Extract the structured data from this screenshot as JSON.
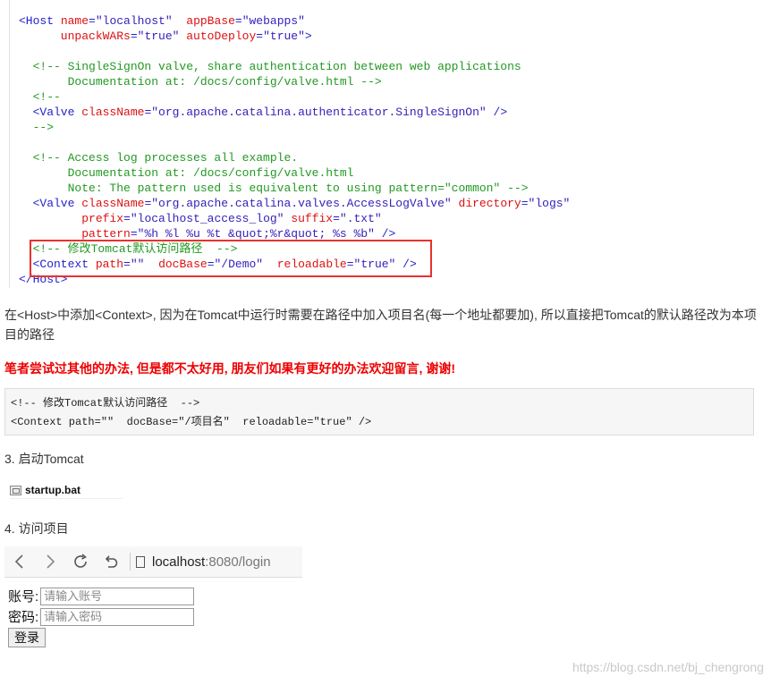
{
  "code_lines": [
    {
      "parts": [
        {
          "c": "tag",
          "t": "<Host "
        },
        {
          "c": "attr",
          "t": "name"
        },
        {
          "c": "tag",
          "t": "="
        },
        {
          "c": "val",
          "t": "\"localhost\""
        },
        {
          "c": "attr",
          "t": "  appBase"
        },
        {
          "c": "tag",
          "t": "="
        },
        {
          "c": "val",
          "t": "\"webapps\""
        }
      ]
    },
    {
      "parts": [
        {
          "c": "attr",
          "t": "      unpackWARs"
        },
        {
          "c": "tag",
          "t": "="
        },
        {
          "c": "val",
          "t": "\"true\""
        },
        {
          "c": "attr",
          "t": " autoDeploy"
        },
        {
          "c": "tag",
          "t": "="
        },
        {
          "c": "val",
          "t": "\"true\""
        },
        {
          "c": "tag",
          "t": ">"
        }
      ]
    },
    {
      "parts": [
        {
          "c": "cmt",
          "t": ""
        }
      ]
    },
    {
      "parts": [
        {
          "c": "cmt",
          "t": "  <!-- SingleSignOn valve, share authentication between web applications"
        }
      ]
    },
    {
      "parts": [
        {
          "c": "cmt",
          "t": "       Documentation at: /docs/config/valve.html -->"
        }
      ]
    },
    {
      "parts": [
        {
          "c": "cmt",
          "t": "  <!--"
        }
      ]
    },
    {
      "parts": [
        {
          "c": "tag",
          "t": "  <Valve "
        },
        {
          "c": "attr",
          "t": "className"
        },
        {
          "c": "tag",
          "t": "="
        },
        {
          "c": "val",
          "t": "\"org.apache.catalina.authenticator.SingleSignOn\""
        },
        {
          "c": "tag",
          "t": " />"
        }
      ]
    },
    {
      "parts": [
        {
          "c": "cmt",
          "t": "  -->"
        }
      ]
    },
    {
      "parts": [
        {
          "c": "cmt",
          "t": ""
        }
      ]
    },
    {
      "parts": [
        {
          "c": "cmt",
          "t": "  <!-- Access log processes all example."
        }
      ]
    },
    {
      "parts": [
        {
          "c": "cmt",
          "t": "       Documentation at: /docs/config/valve.html"
        }
      ]
    },
    {
      "parts": [
        {
          "c": "cmt",
          "t": "       Note: The pattern used is equivalent to using pattern=\"common\" -->"
        }
      ]
    },
    {
      "parts": [
        {
          "c": "tag",
          "t": "  <Valve "
        },
        {
          "c": "attr",
          "t": "className"
        },
        {
          "c": "tag",
          "t": "="
        },
        {
          "c": "val",
          "t": "\"org.apache.catalina.valves.AccessLogValve\""
        },
        {
          "c": "attr",
          "t": " directory"
        },
        {
          "c": "tag",
          "t": "="
        },
        {
          "c": "val",
          "t": "\"logs\""
        }
      ]
    },
    {
      "parts": [
        {
          "c": "attr",
          "t": "         prefix"
        },
        {
          "c": "tag",
          "t": "="
        },
        {
          "c": "val",
          "t": "\"localhost_access_log\""
        },
        {
          "c": "attr",
          "t": " suffix"
        },
        {
          "c": "tag",
          "t": "="
        },
        {
          "c": "val",
          "t": "\".txt\""
        }
      ]
    },
    {
      "parts": [
        {
          "c": "attr",
          "t": "         pattern"
        },
        {
          "c": "tag",
          "t": "="
        },
        {
          "c": "val",
          "t": "\"%h %l %u %t &quot;%r&quot; %s %b\""
        },
        {
          "c": "tag",
          "t": " />"
        }
      ]
    },
    {
      "parts": [
        {
          "c": "cmt",
          "t": "  <!-- 修改Tomcat默认访问路径  -->"
        }
      ]
    },
    {
      "parts": [
        {
          "c": "tag",
          "t": "  <Context "
        },
        {
          "c": "attr",
          "t": "path"
        },
        {
          "c": "tag",
          "t": "="
        },
        {
          "c": "val",
          "t": "\"\""
        },
        {
          "c": "attr",
          "t": "  docBase"
        },
        {
          "c": "tag",
          "t": "="
        },
        {
          "c": "val",
          "t": "\"/Demo\""
        },
        {
          "c": "attr",
          "t": "  reloadable"
        },
        {
          "c": "tag",
          "t": "="
        },
        {
          "c": "val",
          "t": "\"true\""
        },
        {
          "c": "tag",
          "t": " />"
        }
      ]
    },
    {
      "parts": [
        {
          "c": "tag",
          "t": "</Host>"
        }
      ]
    }
  ],
  "paragraph": "在<Host>中添加<Context>, 因为在Tomcat中运行时需要在路径中加入项目名(每一个地址都要加), 所以直接把Tomcat的默认路径改为本项目的路径",
  "note": "笔者尝试过其他的办法, 但是都不太好用, 朋友们如果有更好的办法欢迎留言, 谢谢!",
  "snippet": "<!-- 修改Tomcat默认访问路径  -->\n<Context path=\"\"  docBase=\"/项目名\"  reloadable=\"true\" />",
  "step3": "3. 启动Tomcat",
  "file_name": "startup.bat",
  "step4": "4. 访问项目",
  "browser": {
    "host": "localhost",
    "rest": ":8080/login"
  },
  "login": {
    "account_label": "账号:",
    "account_placeholder": "请输入账号",
    "password_label": "密码:",
    "password_placeholder": "请输入密码",
    "submit": "登录"
  },
  "watermark": "https://blog.csdn.net/bj_chengrong"
}
